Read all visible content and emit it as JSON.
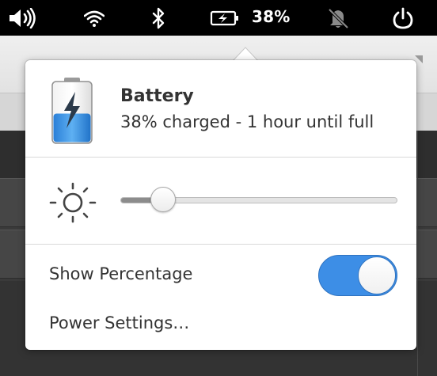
{
  "panel": {
    "icons": [
      "volume-icon",
      "wifi-icon",
      "bluetooth-icon",
      "battery-charging-icon",
      "notifications-off-icon",
      "power-icon"
    ],
    "battery_percent": "38%"
  },
  "popover": {
    "title": "Battery",
    "subtitle": "38% charged - 1 hour until full",
    "battery_level": 0.38,
    "brightness_level": 0.12,
    "show_percentage": {
      "label": "Show Percentage",
      "enabled": true
    },
    "power_settings_label": "Power Settings…"
  },
  "colors": {
    "panel_bg": "#000000",
    "accent": "#3d8ee6",
    "battery_fill": "#2f8fe0",
    "text": "#333333"
  }
}
